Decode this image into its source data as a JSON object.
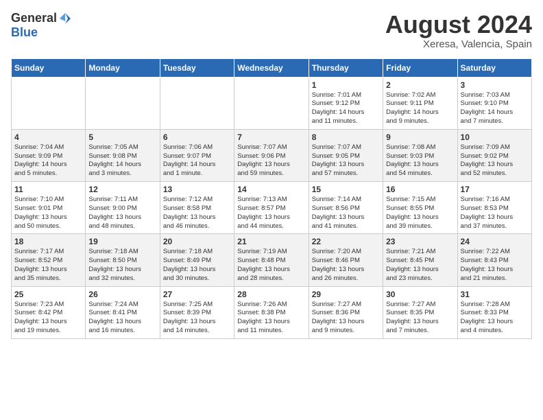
{
  "header": {
    "logo_general": "General",
    "logo_blue": "Blue",
    "month_year": "August 2024",
    "location": "Xeresa, Valencia, Spain"
  },
  "weekdays": [
    "Sunday",
    "Monday",
    "Tuesday",
    "Wednesday",
    "Thursday",
    "Friday",
    "Saturday"
  ],
  "weeks": [
    [
      {
        "day": "",
        "content": ""
      },
      {
        "day": "",
        "content": ""
      },
      {
        "day": "",
        "content": ""
      },
      {
        "day": "",
        "content": ""
      },
      {
        "day": "1",
        "content": "Sunrise: 7:01 AM\nSunset: 9:12 PM\nDaylight: 14 hours\nand 11 minutes."
      },
      {
        "day": "2",
        "content": "Sunrise: 7:02 AM\nSunset: 9:11 PM\nDaylight: 14 hours\nand 9 minutes."
      },
      {
        "day": "3",
        "content": "Sunrise: 7:03 AM\nSunset: 9:10 PM\nDaylight: 14 hours\nand 7 minutes."
      }
    ],
    [
      {
        "day": "4",
        "content": "Sunrise: 7:04 AM\nSunset: 9:09 PM\nDaylight: 14 hours\nand 5 minutes."
      },
      {
        "day": "5",
        "content": "Sunrise: 7:05 AM\nSunset: 9:08 PM\nDaylight: 14 hours\nand 3 minutes."
      },
      {
        "day": "6",
        "content": "Sunrise: 7:06 AM\nSunset: 9:07 PM\nDaylight: 14 hours\nand 1 minute."
      },
      {
        "day": "7",
        "content": "Sunrise: 7:07 AM\nSunset: 9:06 PM\nDaylight: 13 hours\nand 59 minutes."
      },
      {
        "day": "8",
        "content": "Sunrise: 7:07 AM\nSunset: 9:05 PM\nDaylight: 13 hours\nand 57 minutes."
      },
      {
        "day": "9",
        "content": "Sunrise: 7:08 AM\nSunset: 9:03 PM\nDaylight: 13 hours\nand 54 minutes."
      },
      {
        "day": "10",
        "content": "Sunrise: 7:09 AM\nSunset: 9:02 PM\nDaylight: 13 hours\nand 52 minutes."
      }
    ],
    [
      {
        "day": "11",
        "content": "Sunrise: 7:10 AM\nSunset: 9:01 PM\nDaylight: 13 hours\nand 50 minutes."
      },
      {
        "day": "12",
        "content": "Sunrise: 7:11 AM\nSunset: 9:00 PM\nDaylight: 13 hours\nand 48 minutes."
      },
      {
        "day": "13",
        "content": "Sunrise: 7:12 AM\nSunset: 8:58 PM\nDaylight: 13 hours\nand 46 minutes."
      },
      {
        "day": "14",
        "content": "Sunrise: 7:13 AM\nSunset: 8:57 PM\nDaylight: 13 hours\nand 44 minutes."
      },
      {
        "day": "15",
        "content": "Sunrise: 7:14 AM\nSunset: 8:56 PM\nDaylight: 13 hours\nand 41 minutes."
      },
      {
        "day": "16",
        "content": "Sunrise: 7:15 AM\nSunset: 8:55 PM\nDaylight: 13 hours\nand 39 minutes."
      },
      {
        "day": "17",
        "content": "Sunrise: 7:16 AM\nSunset: 8:53 PM\nDaylight: 13 hours\nand 37 minutes."
      }
    ],
    [
      {
        "day": "18",
        "content": "Sunrise: 7:17 AM\nSunset: 8:52 PM\nDaylight: 13 hours\nand 35 minutes."
      },
      {
        "day": "19",
        "content": "Sunrise: 7:18 AM\nSunset: 8:50 PM\nDaylight: 13 hours\nand 32 minutes."
      },
      {
        "day": "20",
        "content": "Sunrise: 7:18 AM\nSunset: 8:49 PM\nDaylight: 13 hours\nand 30 minutes."
      },
      {
        "day": "21",
        "content": "Sunrise: 7:19 AM\nSunset: 8:48 PM\nDaylight: 13 hours\nand 28 minutes."
      },
      {
        "day": "22",
        "content": "Sunrise: 7:20 AM\nSunset: 8:46 PM\nDaylight: 13 hours\nand 26 minutes."
      },
      {
        "day": "23",
        "content": "Sunrise: 7:21 AM\nSunset: 8:45 PM\nDaylight: 13 hours\nand 23 minutes."
      },
      {
        "day": "24",
        "content": "Sunrise: 7:22 AM\nSunset: 8:43 PM\nDaylight: 13 hours\nand 21 minutes."
      }
    ],
    [
      {
        "day": "25",
        "content": "Sunrise: 7:23 AM\nSunset: 8:42 PM\nDaylight: 13 hours\nand 19 minutes."
      },
      {
        "day": "26",
        "content": "Sunrise: 7:24 AM\nSunset: 8:41 PM\nDaylight: 13 hours\nand 16 minutes."
      },
      {
        "day": "27",
        "content": "Sunrise: 7:25 AM\nSunset: 8:39 PM\nDaylight: 13 hours\nand 14 minutes."
      },
      {
        "day": "28",
        "content": "Sunrise: 7:26 AM\nSunset: 8:38 PM\nDaylight: 13 hours\nand 11 minutes."
      },
      {
        "day": "29",
        "content": "Sunrise: 7:27 AM\nSunset: 8:36 PM\nDaylight: 13 hours\nand 9 minutes."
      },
      {
        "day": "30",
        "content": "Sunrise: 7:27 AM\nSunset: 8:35 PM\nDaylight: 13 hours\nand 7 minutes."
      },
      {
        "day": "31",
        "content": "Sunrise: 7:28 AM\nSunset: 8:33 PM\nDaylight: 13 hours\nand 4 minutes."
      }
    ]
  ]
}
